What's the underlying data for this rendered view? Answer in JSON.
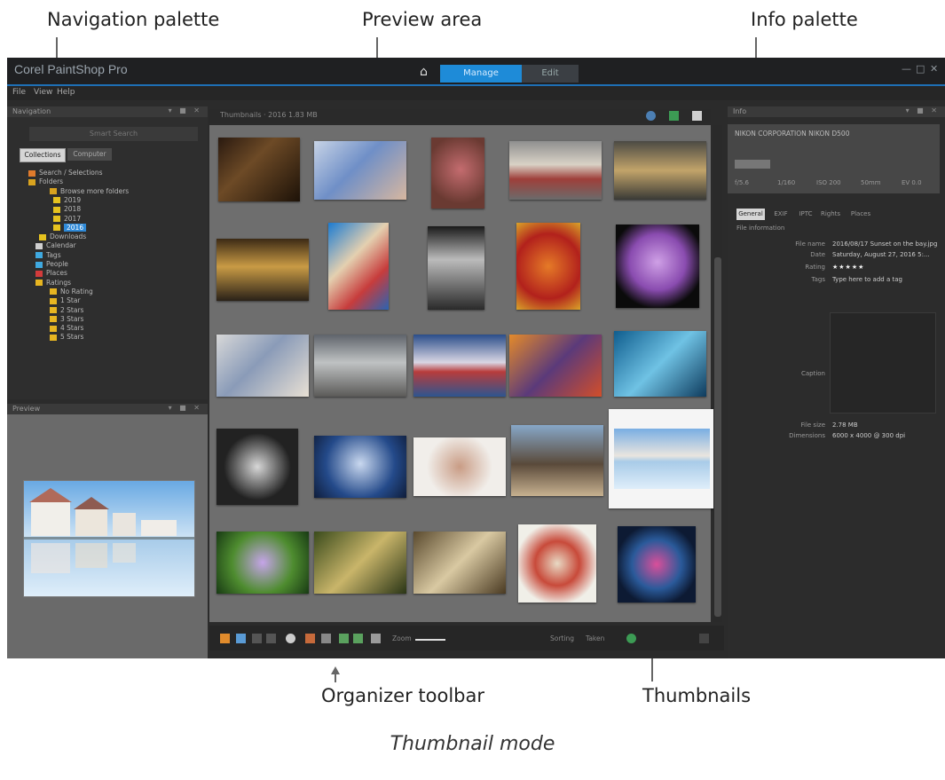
{
  "callouts": {
    "navigation_palette": "Navigation palette",
    "preview_area": "Preview area",
    "info_palette": "Info palette",
    "organizer_toolbar": "Organizer toolbar",
    "thumbnails": "Thumbnails"
  },
  "caption": "Thumbnail mode",
  "app": {
    "title": "Corel PaintShop Pro",
    "tabs": {
      "manage": "Manage",
      "edit": "Edit"
    },
    "menu": [
      "File",
      "View",
      "Help"
    ]
  },
  "navigation": {
    "title": "Navigation",
    "search_placeholder": "Smart Search",
    "tabs": {
      "collections": "Collections",
      "computer": "Computer"
    },
    "tree": [
      {
        "label": "Search / Selections",
        "color": "#e07b2c"
      },
      {
        "label": "Folders",
        "color": "#d9a31f"
      },
      {
        "label": "Browse more folders",
        "color": "#d9a31f"
      },
      {
        "label": "2019",
        "color": "#e6c21f"
      },
      {
        "label": "2018",
        "color": "#e6c21f"
      },
      {
        "label": "2017",
        "color": "#e6c21f"
      },
      {
        "label": "2016",
        "color": "#e6c21f",
        "selected": true
      },
      {
        "label": "Downloads",
        "color": "#e6c21f"
      },
      {
        "label": "Calendar",
        "color": "#cfcfcf"
      },
      {
        "label": "Tags",
        "color": "#3fa9e0"
      },
      {
        "label": "People",
        "color": "#3fa9e0"
      },
      {
        "label": "Places",
        "color": "#d23b3b"
      },
      {
        "label": "Ratings",
        "color": "#e7b521"
      },
      {
        "label": "No Rating",
        "color": "#e7b521"
      },
      {
        "label": "1 Star",
        "color": "#e7b521"
      },
      {
        "label": "2 Stars",
        "color": "#e7b521"
      },
      {
        "label": "3 Stars",
        "color": "#e7b521"
      },
      {
        "label": "4 Stars",
        "color": "#e7b521"
      },
      {
        "label": "5 Stars",
        "color": "#e7b521"
      }
    ]
  },
  "preview_panel": {
    "title": "Preview"
  },
  "thumbnails_panel": {
    "header": "Thumbnails  ·  2016  1.83 MB"
  },
  "toolbar": {
    "zoom_label": "Zoom",
    "sort_label": "Sorting",
    "sort_value": "Taken"
  },
  "info": {
    "title": "Info",
    "camera": "NIKON CORPORATION NIKON D500",
    "exif_values": [
      "f/5.6",
      "1/160",
      "ISO 200",
      "50mm",
      "EV 0.0"
    ],
    "tabs": [
      "General",
      "EXIF",
      "IPTC",
      "Rights",
      "Places"
    ],
    "section": "File information",
    "rows": [
      {
        "label": "File name",
        "value": "2016/08/17 Sunset on the bay.jpg"
      },
      {
        "label": "Date",
        "value": "Saturday, August 27, 2016 5:..."
      },
      {
        "label": "Rating",
        "value": "★★★★★"
      },
      {
        "label": "Tags",
        "value": "Type here to add a tag"
      },
      {
        "label": "Caption",
        "value": ""
      },
      {
        "label": "File size",
        "value": "2.78 MB"
      },
      {
        "label": "Dimensions",
        "value": "6000 x 4000 @ 300 dpi"
      }
    ]
  },
  "colors": {
    "accent": "#1e8bd8",
    "background": "#2b2b2b",
    "grid_background": "#6e6e6e"
  }
}
